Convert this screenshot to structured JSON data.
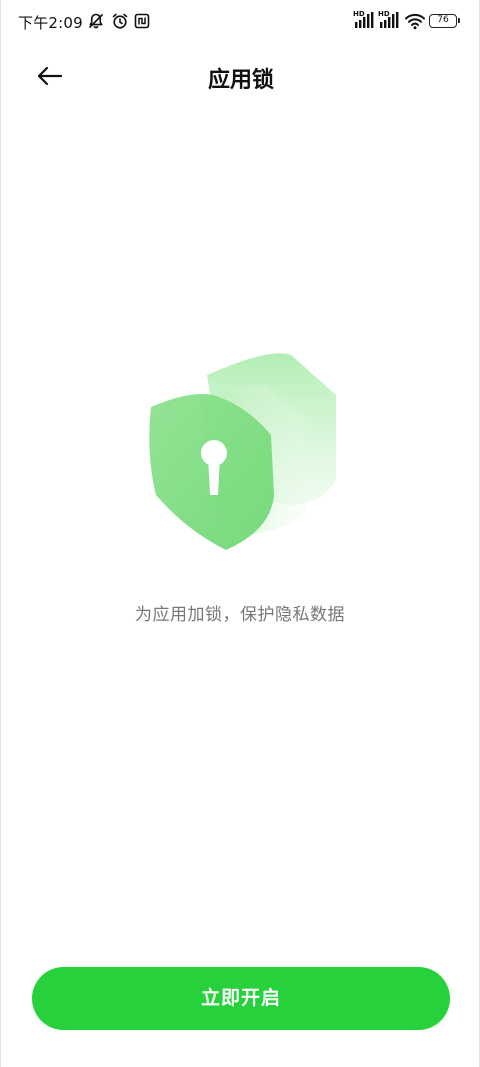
{
  "status_bar": {
    "time": "下午2:09",
    "battery": "76",
    "hd_label": "HD",
    "icons": [
      "mute-bell-icon",
      "alarm-icon",
      "nfc-icon",
      "signal-icon",
      "wifi-icon",
      "battery-icon"
    ]
  },
  "header": {
    "title": "应用锁",
    "back_icon": "arrow-left-icon"
  },
  "main": {
    "illustration": "shield-lock-icon",
    "subtitle": "为应用加锁，保护隐私数据"
  },
  "actions": {
    "enable_label": "立即开启"
  },
  "colors": {
    "accent": "#27d13c",
    "shield_green": "#8fe08f",
    "text_primary": "#111111",
    "text_secondary": "#777777"
  }
}
